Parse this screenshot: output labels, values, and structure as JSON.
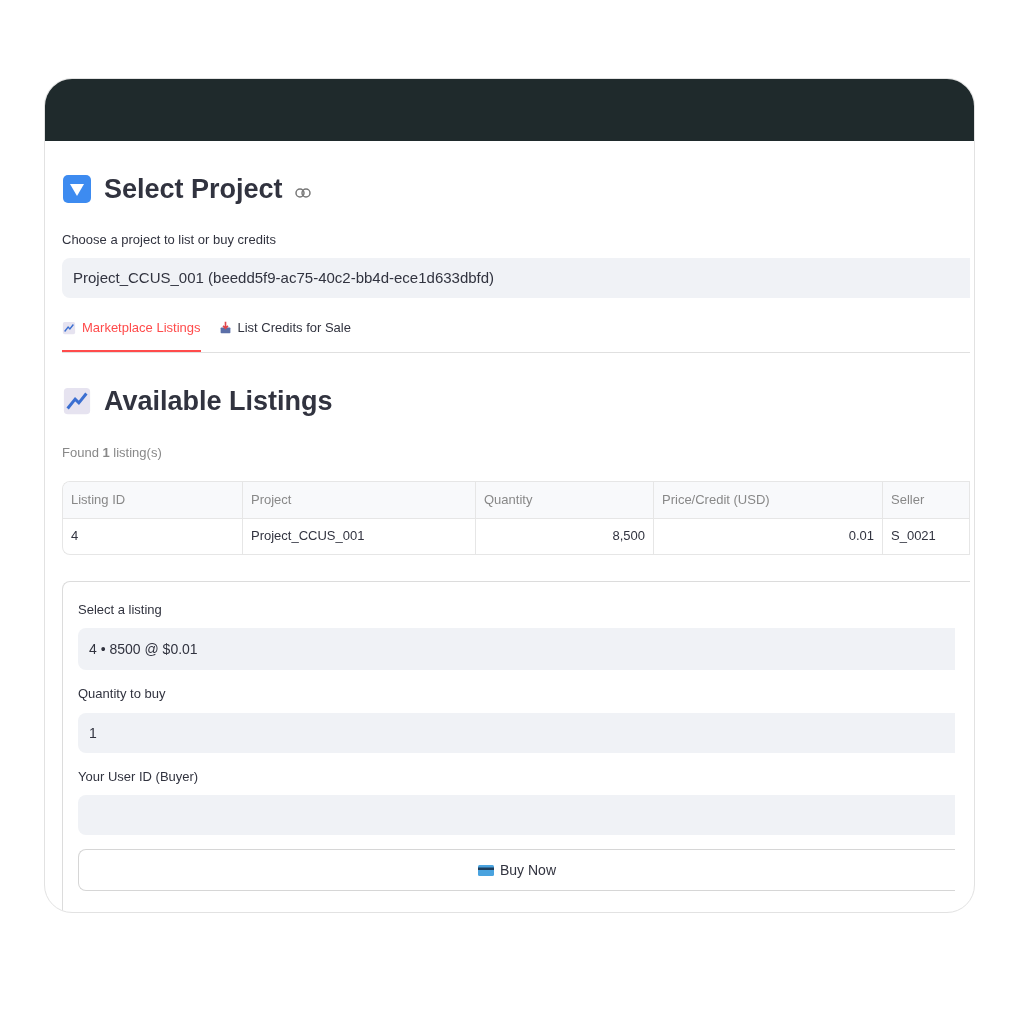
{
  "project_section": {
    "title": "Select Project",
    "select_label": "Choose a project to list or buy credits",
    "select_value": "Project_CCUS_001 (beedd5f9-ac75-40c2-bb4d-ece1d633dbfd)"
  },
  "tabs": [
    {
      "label": "Marketplace Listings",
      "selected": true,
      "kind": "chart"
    },
    {
      "label": "List Credits for Sale",
      "selected": false,
      "kind": "upload"
    }
  ],
  "listings": {
    "title": "Available Listings",
    "summary": "Found **1** listing(s)",
    "table": {
      "columns": [
        "Listing ID",
        "Project",
        "Quantity",
        "Price/Credit (USD)",
        "Seller"
      ],
      "rows": [
        [
          "4",
          "Project_CCUS_001",
          "8,500",
          "0.01",
          "S_0021"
        ]
      ]
    }
  },
  "buy_form": {
    "fields": [
      {
        "label": "Select a listing",
        "value": "4 • 8500 @ $0.01",
        "kind": "select"
      },
      {
        "label": "Quantity to buy",
        "value": "1",
        "kind": "number"
      },
      {
        "label": "Your User ID (Buyer)",
        "kind": "text"
      }
    ],
    "button": "Buy Now"
  }
}
